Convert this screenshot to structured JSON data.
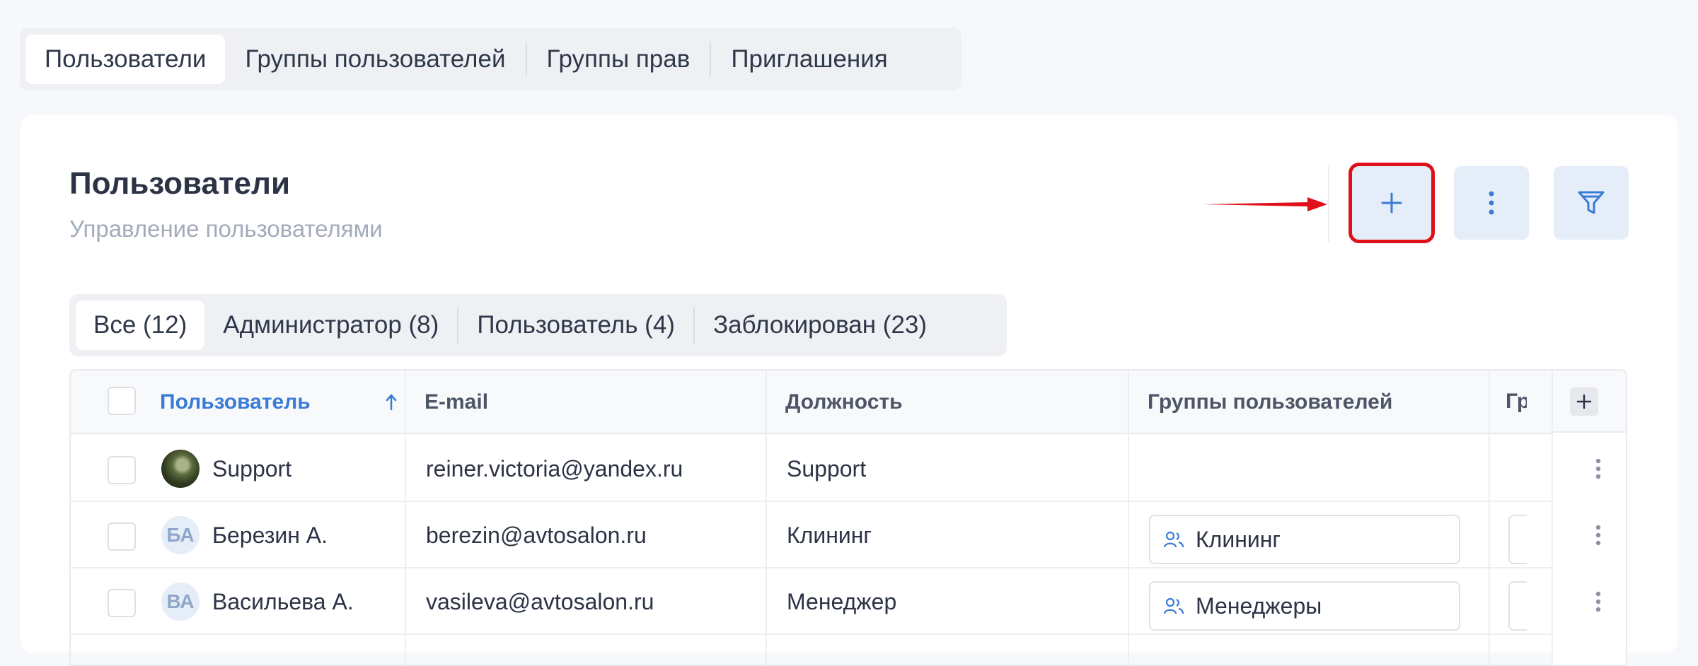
{
  "top_tabs": [
    {
      "label": "Пользователи",
      "active": true
    },
    {
      "label": "Группы пользователей",
      "active": false
    },
    {
      "label": "Группы прав",
      "active": false
    },
    {
      "label": "Приглашения",
      "active": false
    }
  ],
  "header": {
    "title": "Пользователи",
    "subtitle": "Управление пользователями"
  },
  "actions": {
    "add_icon": "plus-icon",
    "more_icon": "vertical-dots-icon",
    "filter_icon": "funnel-icon",
    "highlight_color": "#e0101a"
  },
  "role_tabs": [
    {
      "label": "Все (12)",
      "active": true
    },
    {
      "label": "Администратор (8)",
      "active": false
    },
    {
      "label": "Пользователь (4)",
      "active": false
    },
    {
      "label": "Заблокирован (23)",
      "active": false
    }
  ],
  "table": {
    "columns": {
      "user": "Пользователь",
      "email": "E-mail",
      "position": "Должность",
      "groups": "Группы пользователей",
      "truncated": "Гр"
    },
    "sort_icon": "arrow-up-icon",
    "rows": [
      {
        "initials": "",
        "name": "Support",
        "email": "reiner.victoria@yandex.ru",
        "position": "Support",
        "group": ""
      },
      {
        "initials": "БА",
        "name": "Березин А.",
        "email": "berezin@avtosalon.ru",
        "position": "Клининг",
        "group": "Клининг"
      },
      {
        "initials": "ВА",
        "name": "Васильева А.",
        "email": "vasileva@avtosalon.ru",
        "position": "Менеджер",
        "group": "Менеджеры"
      }
    ]
  },
  "colors": {
    "accent": "#3a7bd5",
    "button_bg": "#e5eef8"
  }
}
